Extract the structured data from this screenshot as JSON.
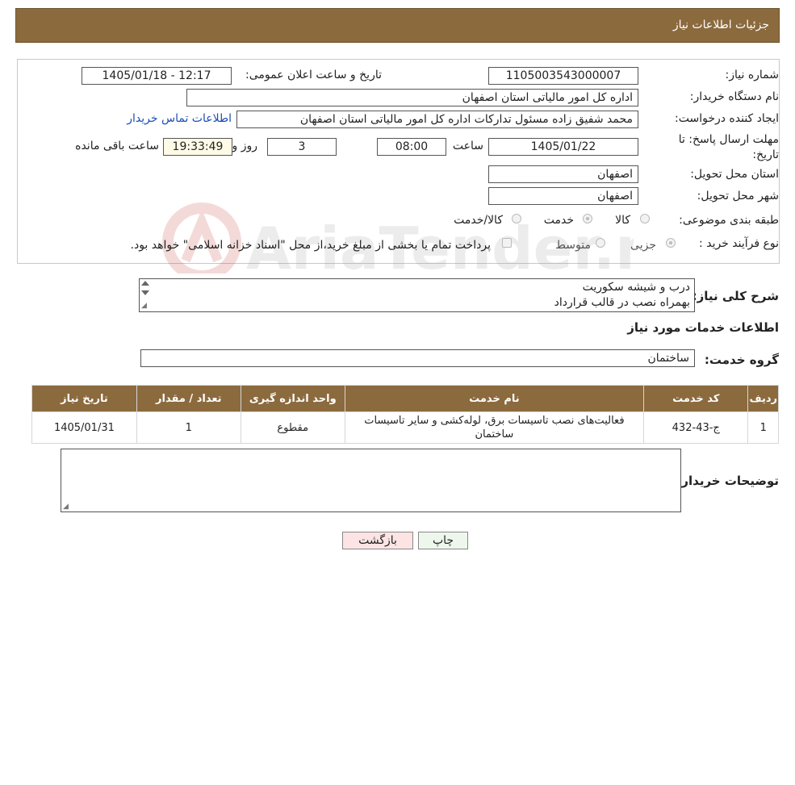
{
  "header": {
    "title": "جزئیات اطلاعات نیاز"
  },
  "form": {
    "need_number_label": "شماره نیاز:",
    "need_number": "1105003543000007",
    "announce_label": "تاریخ و ساعت اعلان عمومی:",
    "announce_value": "1405/01/18 - 12:17",
    "buyer_org_label": "نام دستگاه خریدار:",
    "buyer_org": "اداره کل امور مالیاتی استان اصفهان",
    "creator_label": "ایجاد کننده درخواست:",
    "creator": "محمد شفیق زاده مسئول تدارکات اداره کل امور مالیاتی استان اصفهان",
    "contact_link": "اطلاعات تماس خریدار",
    "deadline_label_1": "مهلت ارسال پاسخ: تا",
    "deadline_label_2": "تاریخ:",
    "deadline_date": "1405/01/22",
    "time_label": "ساعت",
    "deadline_time": "08:00",
    "days_value": "3",
    "days_label": "روز و",
    "remaining_time": "19:33:49",
    "remaining_label": "ساعت باقی مانده",
    "province_label": "استان محل تحویل:",
    "province": "اصفهان",
    "city_label": "شهر محل تحویل:",
    "city": "اصفهان",
    "category_label": "طبقه بندی موضوعی:",
    "category_options": [
      "کالا",
      "خدمت",
      "کالا/خدمت"
    ],
    "process_label": "نوع فرآیند خرید :",
    "process_options": [
      "جزیی",
      "متوسط"
    ],
    "process_note": "پرداخت تمام یا بخشی از مبلغ خرید،از محل \"اسناد خزانه اسلامی\" خواهد بود."
  },
  "description": {
    "label": "شرح کلی نیاز:",
    "line1": "درب و شیشه سکوریت",
    "line2": "بهمراه نصب در قالب قرارداد"
  },
  "services": {
    "title": "اطلاعات خدمات مورد نیاز",
    "group_label": "گروه خدمت:",
    "group_value": "ساختمان",
    "columns": [
      "ردیف",
      "کد خدمت",
      "نام خدمت",
      "واحد اندازه گیری",
      "تعداد / مقدار",
      "تاریخ نیاز"
    ],
    "rows": [
      {
        "index": "1",
        "code": "ج-43-432",
        "name": "فعالیت‌های نصب تاسیسات برق، لوله‌کشی و سایر تاسیسات ساختمان",
        "unit": "مقطوع",
        "qty": "1",
        "date": "1405/01/31"
      }
    ]
  },
  "buyer_notes": {
    "label": "توضیحات خریدار:",
    "value": ""
  },
  "buttons": {
    "print": "چاپ",
    "back": "بازگشت"
  },
  "watermark": {
    "text": "AriaTender.neT"
  },
  "colors": {
    "header_bg": "#8b6a3e",
    "link": "#1a4fb5",
    "back_button_bg": "#fce4e4",
    "print_button_bg": "#eef7ec"
  }
}
